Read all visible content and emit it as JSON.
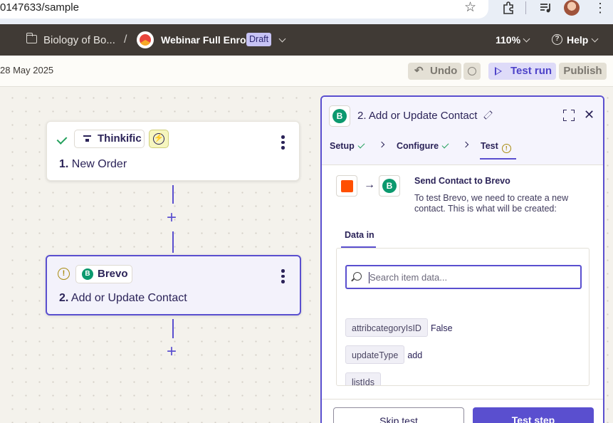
{
  "browser": {
    "url": "0147633/sample",
    "star_icon": "star-icon",
    "extensions_icon": "puzzle-icon",
    "media_icon": "media-queue-icon"
  },
  "header": {
    "breadcrumb_folder": "Biology of Bo...",
    "separator": "/",
    "zap_title": "Webinar Full Enrol",
    "status_badge": "Draft",
    "zoom": "110%",
    "help": "Help"
  },
  "toolbar": {
    "date": "28 May 2025",
    "undo": "Undo",
    "test_run": "Test run",
    "publish": "Publish"
  },
  "canvas": {
    "steps": [
      {
        "app": "Thinkific",
        "number": "1.",
        "title": "New Order",
        "status": "complete"
      },
      {
        "app": "Brevo",
        "number": "2.",
        "title": "Add or Update Contact",
        "status": "warning"
      }
    ]
  },
  "panel": {
    "title": "2. Add or Update Contact",
    "tabs": [
      {
        "label": "Setup",
        "status": "complete"
      },
      {
        "label": "Configure",
        "status": "complete"
      },
      {
        "label": "Test",
        "status": "warning"
      }
    ],
    "send_title": "Send Contact to Brevo",
    "send_desc": "To test Brevo, we need to create a new contact. This is what will be created:",
    "data_tab": "Data in",
    "search_placeholder": "Search item data...",
    "fields": [
      {
        "key": "attribcategoryIsID",
        "value": "False"
      },
      {
        "key": "updateType",
        "value": "add"
      },
      {
        "key": "listIds",
        "value": ""
      }
    ],
    "skip_test": "Skip test",
    "test_step": "Test step"
  },
  "colors": {
    "accent": "#5a4fcf",
    "brevo": "#0b996e",
    "zapier_orange": "#ff4f00",
    "header_bg": "#403a35"
  }
}
